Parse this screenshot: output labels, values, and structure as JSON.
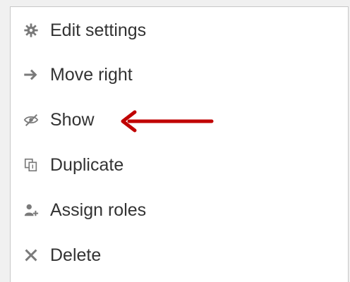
{
  "menu": {
    "items": [
      {
        "label": "Edit settings",
        "icon": "gear-icon"
      },
      {
        "label": "Move right",
        "icon": "arrow-right-icon"
      },
      {
        "label": "Show",
        "icon": "eye-hidden-icon"
      },
      {
        "label": "Duplicate",
        "icon": "duplicate-icon"
      },
      {
        "label": "Assign roles",
        "icon": "user-plus-icon"
      },
      {
        "label": "Delete",
        "icon": "close-icon"
      }
    ]
  },
  "annotation": {
    "pointer_target": "Show",
    "color": "#c00000"
  },
  "colors": {
    "icon": "#7a7a7a",
    "text": "#333333"
  }
}
